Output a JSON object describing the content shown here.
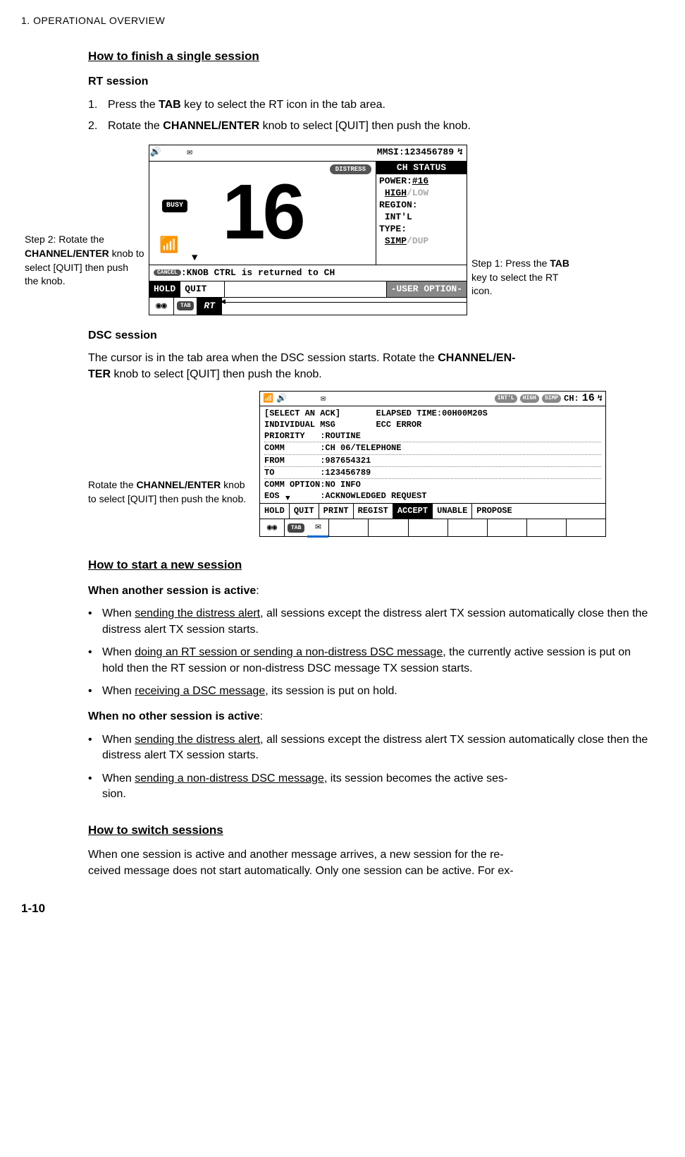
{
  "header": "1.  OPERATIONAL OVERVIEW",
  "s1": {
    "title": "How to finish a single session",
    "rt_head": "RT session",
    "step1_pre": "Press the ",
    "step1_b": "TAB",
    "step1_post": " key to select the RT icon in the tab area.",
    "step2_pre": "Rotate the ",
    "step2_b": "CHANNEL/ENTER",
    "step2_post": " knob to select [QUIT] then push the knob."
  },
  "fig1": {
    "left_cap_l1a": "Step 2: Rotate the",
    "left_cap_l1b": "CHANNEL/ENTER",
    "left_cap_l2": "knob to select [QUIT] then push the knob.",
    "right_cap_l1a": "Step 1: Press the",
    "right_cap_l1b": "TAB",
    "right_cap_l2": " key to select the RT icon.",
    "mmsi": "MMSI:123456789",
    "distress": "DISTRESS",
    "busy": "BUSY",
    "ch": "16",
    "status_hd": "CH STATUS",
    "power_lbl": "POWER:",
    "power_val": "#16",
    "hl_high": "HIGH",
    "hl_low": "/LOW",
    "region_lbl": "REGION:",
    "region_val": "INT'L",
    "type_lbl": "TYPE:",
    "simp": "SIMP",
    "dup": "/DUP",
    "cancel": "CANCEL",
    "cancel_msg": ":KNOB CTRL is returned to CH",
    "hold": "HOLD",
    "quit": "QUIT",
    "useropt": "-USER OPTION-",
    "tab": "TAB",
    "rt": "RT"
  },
  "s2": {
    "dsc_head": "DSC session",
    "dsc_text_a": "The cursor is in the tab area when the DSC session starts. Rotate the ",
    "dsc_text_b": "CHANNEL/EN-",
    "dsc_text_c": "TER",
    "dsc_text_d": " knob to select [QUIT] then push the knob."
  },
  "fig2": {
    "left_cap_a": "Rotate the ",
    "left_cap_b": "CHANNEL/ENTER",
    "left_cap_c": " knob to select [QUIT] then push the knob.",
    "p1": "INT'L",
    "p2": "HIGH",
    "p3": "SIMP",
    "ch_lbl": "CH:",
    "ch_val": "16",
    "r1a": "[SELECT AN ACK]",
    "r1b": "ELAPSED TIME:00H00M20S",
    "r2a": "INDIVIDUAL MSG",
    "r2b": "ECC ERROR",
    "r3": "PRIORITY   :ROUTINE",
    "r4": "COMM       :CH 06/TELEPHONE",
    "r5": "FROM       :987654321",
    "r6": "TO         :123456789",
    "r7": "COMM OPTION:NO INFO",
    "r8": "EOS        :ACKNOWLEDGED REQUEST",
    "m1": "HOLD",
    "m2": "QUIT",
    "m3": "PRINT",
    "m4": "REGIST",
    "m5": "ACCEPT",
    "m6": "UNABLE",
    "m7": "PROPOSE",
    "tab": "TAB"
  },
  "s3": {
    "title": "How to start a new session",
    "sub1": "When another session is active",
    "colon": ":",
    "b1a": "When ",
    "b1u": "sending the distress alert",
    "b1b": ", all sessions except the distress alert TX session automatically close then the distress alert TX session starts.",
    "b2a": " When ",
    "b2u": "doing an RT session or sending a non-distress DSC message",
    "b2b": ", the currently active session is put on hold then the RT session or non-distress DSC message TX session starts.",
    "b3a": "When ",
    "b3u": "receiving a DSC message",
    "b3b": ", its session is put on hold.",
    "sub2": "When no other session is active",
    "b4a": "When ",
    "b4u": "sending the distress alert",
    "b4b": ", all sessions except the distress alert TX session automatically close then the distress alert TX session starts.",
    "b5a": "When ",
    "b5u": "sending a non-distress DSC message",
    "b5b": ", its session becomes the active ses",
    "b5c": "sion."
  },
  "s4": {
    "title": "How to switch sessions",
    "para": "When one session is active and another message arrives, a new session for the re-",
    "para2": "ceived message does not start automatically. Only one session can be active. For ex-"
  },
  "pagenum": "1-10"
}
